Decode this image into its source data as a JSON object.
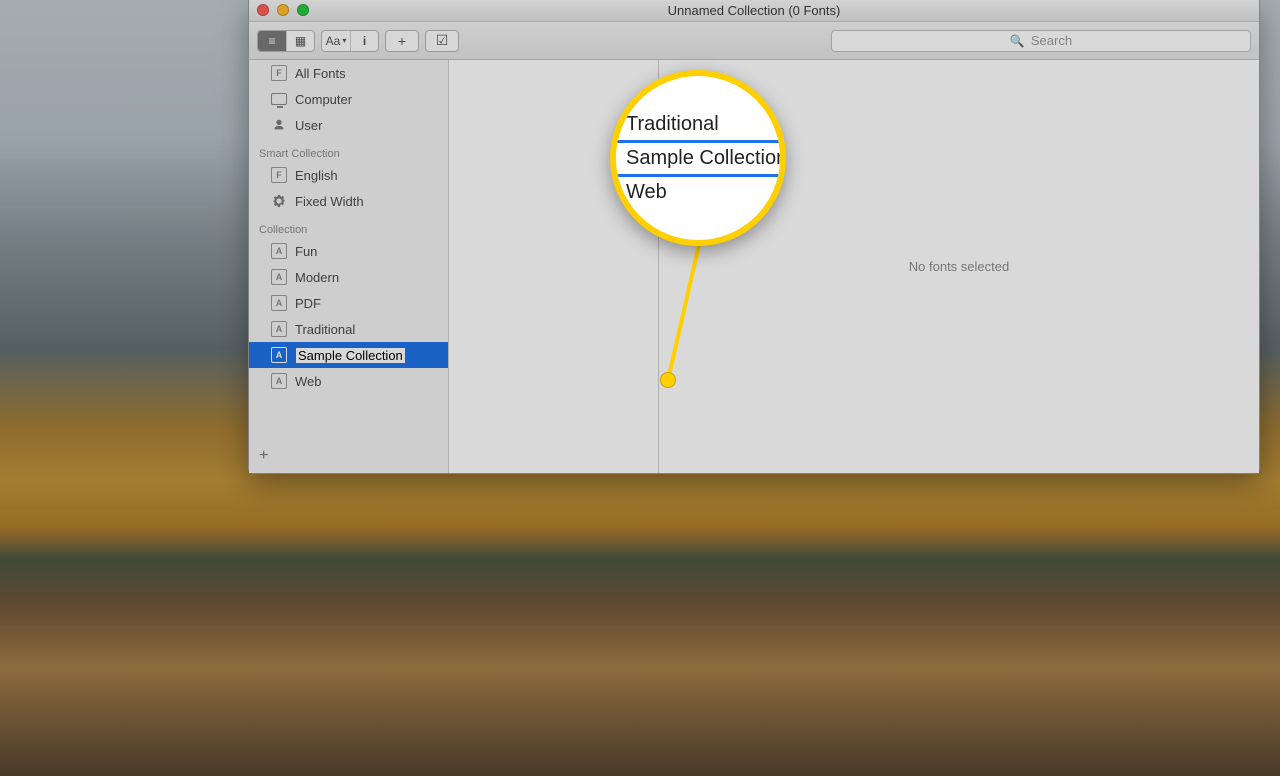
{
  "window": {
    "title": "Unnamed Collection (0 Fonts)"
  },
  "toolbar": {
    "view_list_tip": "List view",
    "view_grid_tip": "Grid view",
    "aa_label": "Aa",
    "info_tip": "Info",
    "add_tip": "Add",
    "check_tip": "Validate",
    "search_placeholder": "Search"
  },
  "sidebar": {
    "top_items": [
      {
        "label": "All Fonts",
        "icon": "f"
      },
      {
        "label": "Computer",
        "icon": "monitor"
      },
      {
        "label": "User",
        "icon": "user"
      }
    ],
    "smart_label": "Smart Collection",
    "smart_items": [
      {
        "label": "English",
        "icon": "f"
      },
      {
        "label": "Fixed Width",
        "icon": "gear"
      }
    ],
    "coll_label": "Collection",
    "coll_items": [
      {
        "label": "Fun"
      },
      {
        "label": "Modern"
      },
      {
        "label": "PDF"
      },
      {
        "label": "Traditional"
      },
      {
        "label": "Sample Collection",
        "editing": true,
        "selected": true
      },
      {
        "label": "Web"
      }
    ],
    "add_label": "+"
  },
  "main": {
    "empty_text": "No fonts selected"
  },
  "callout": {
    "rows": [
      "Traditional",
      "Sample Collection",
      "Web"
    ],
    "highlight_index": 1
  }
}
